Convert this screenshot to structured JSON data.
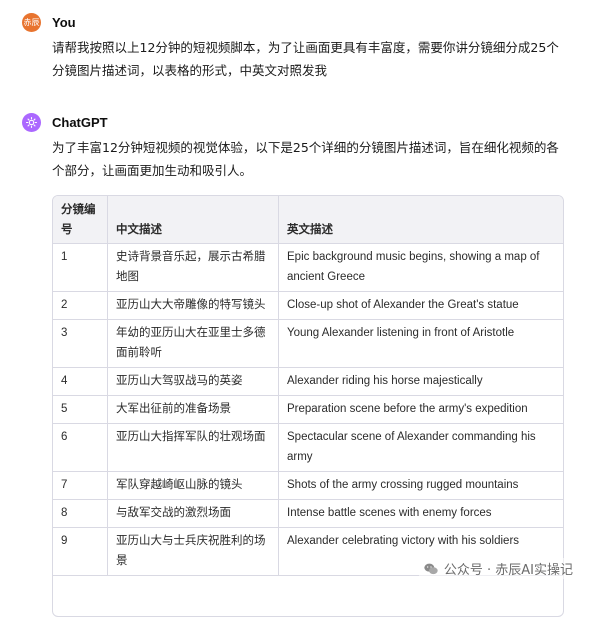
{
  "user": {
    "avatar_text": "赤辰",
    "name": "You",
    "message": "请帮我按照以上12分钟的短视频脚本，为了让画面更具有丰富度，需要你讲分镜细分成25个分镜图片描述词，以表格的形式，中英文对照发我"
  },
  "assistant": {
    "name": "ChatGPT",
    "intro": "为了丰富12分钟短视频的视觉体验，以下是25个详细的分镜图片描述词，旨在细化视频的各个部分，让画面更加生动和吸引人。"
  },
  "table": {
    "headers": [
      "分镜编号",
      "中文描述",
      "英文描述"
    ],
    "rows": [
      {
        "num": "1",
        "cn": "史诗背景音乐起，展示古希腊地图",
        "en": "Epic background music begins, showing a map of ancient Greece"
      },
      {
        "num": "2",
        "cn": "亚历山大大帝雕像的特写镜头",
        "en": "Close-up shot of Alexander the Great's statue"
      },
      {
        "num": "3",
        "cn": "年幼的亚历山大在亚里士多德面前聆听",
        "en": "Young Alexander listening in front of Aristotle"
      },
      {
        "num": "4",
        "cn": "亚历山大驾驭战马的英姿",
        "en": "Alexander riding his horse majestically"
      },
      {
        "num": "5",
        "cn": "大军出征前的准备场景",
        "en": "Preparation scene before the army's expedition"
      },
      {
        "num": "6",
        "cn": "亚历山大指挥军队的壮观场面",
        "en": "Spectacular scene of Alexander commanding his army"
      },
      {
        "num": "7",
        "cn": "军队穿越崎岖山脉的镜头",
        "en": "Shots of the army crossing rugged mountains"
      },
      {
        "num": "8",
        "cn": "与敌军交战的激烈场面",
        "en": "Intense battle scenes with enemy forces"
      },
      {
        "num": "9",
        "cn": "亚历山大与士兵庆祝胜利的场景",
        "en": "Alexander celebrating victory with his soldiers"
      }
    ]
  },
  "watermark": {
    "text": "公众号 · 赤辰AI实操记",
    "icon": "wechat-icon"
  }
}
